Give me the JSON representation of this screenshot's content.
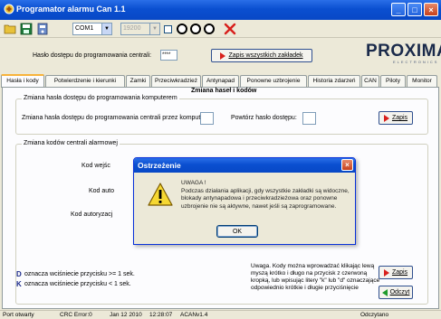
{
  "window": {
    "title": "Programator alarmu Can 1.1",
    "buttons": {
      "minimize": "_",
      "maximize": "□",
      "close": "×"
    }
  },
  "toolbar": {
    "port_value": "COM1",
    "baud_value": "19200",
    "circles_label": "OOO"
  },
  "header": {
    "password_label": "Hasło dostępu do programowania centrali:",
    "password_value": "****",
    "save_all_label": "Zapis wszystkich zakładek",
    "logo_text": "PROXIMA",
    "logo_sub": "ELECTRONICS"
  },
  "tabs": [
    {
      "label": "Hasła i kody"
    },
    {
      "label": "Potwierdzenie i kierunki"
    },
    {
      "label": "Zamki"
    },
    {
      "label": "Przeciwkradzież"
    },
    {
      "label": "Antynapad"
    },
    {
      "label": "Ponowne uzbrojenie"
    },
    {
      "label": "Historia zdarzeń"
    },
    {
      "label": "CAN"
    },
    {
      "label": "Piloty"
    },
    {
      "label": "Monitor"
    }
  ],
  "panel": {
    "heading": "Zmiana haseł i kodów",
    "group1": {
      "title": "Zmiana hasła dostępu do programowania komputerem",
      "change_label": "Zmiana hasła dostępu do programowania centrali przez komputer:",
      "repeat_label": "Powtórz hasło dostępu:",
      "save_label": "Zapis"
    },
    "group2": {
      "title": "Zmiana kodów centrali alarmowej",
      "code_labels": [
        "Kod wejśc",
        "Kod auto",
        "Kod autoryzacj"
      ],
      "note": "Uwaga. Kody można wprowadzać klikając lewą myszą krótko i długo na przycisk z czerwoną kropką, lub wpisując litery \"k\" lub \"d\" oznaczające odpowiednio krótkie i długie przyciśnięcie",
      "legend_d_letter": "D",
      "legend_d_text": "oznacza wciśniecie przycisku >= 1 sek.",
      "legend_k_letter": "K",
      "legend_k_text": "oznacza wciśniecie przycisku < 1 sek.",
      "save_label": "Zapis",
      "read_label": "Odczyt"
    }
  },
  "statusbar": {
    "port": "Port otwarty",
    "crc": "CRC Error:0",
    "date": "Jan 12 2010",
    "time": "12:28:07",
    "version": "ACANv1.4",
    "status": "Odczytano"
  },
  "dialog": {
    "title": "Ostrzeżenie",
    "line1": "UWAGA !",
    "line2": "Podczas działania aplikacji, gdy wszystkie zakładki są widoczne, blokady antynapadowa i przeciwkradzieżowa oraz ponowne uzbrojenie nie są aktywne, nawet jeśli są zaprogramowane.",
    "ok_label": "OK"
  },
  "colors": {
    "title_bar": "#0a4fd0",
    "arrow_red": "#d8201c",
    "arrow_green": "#1d9a2b",
    "tab_highlight": "#f8b33a"
  }
}
